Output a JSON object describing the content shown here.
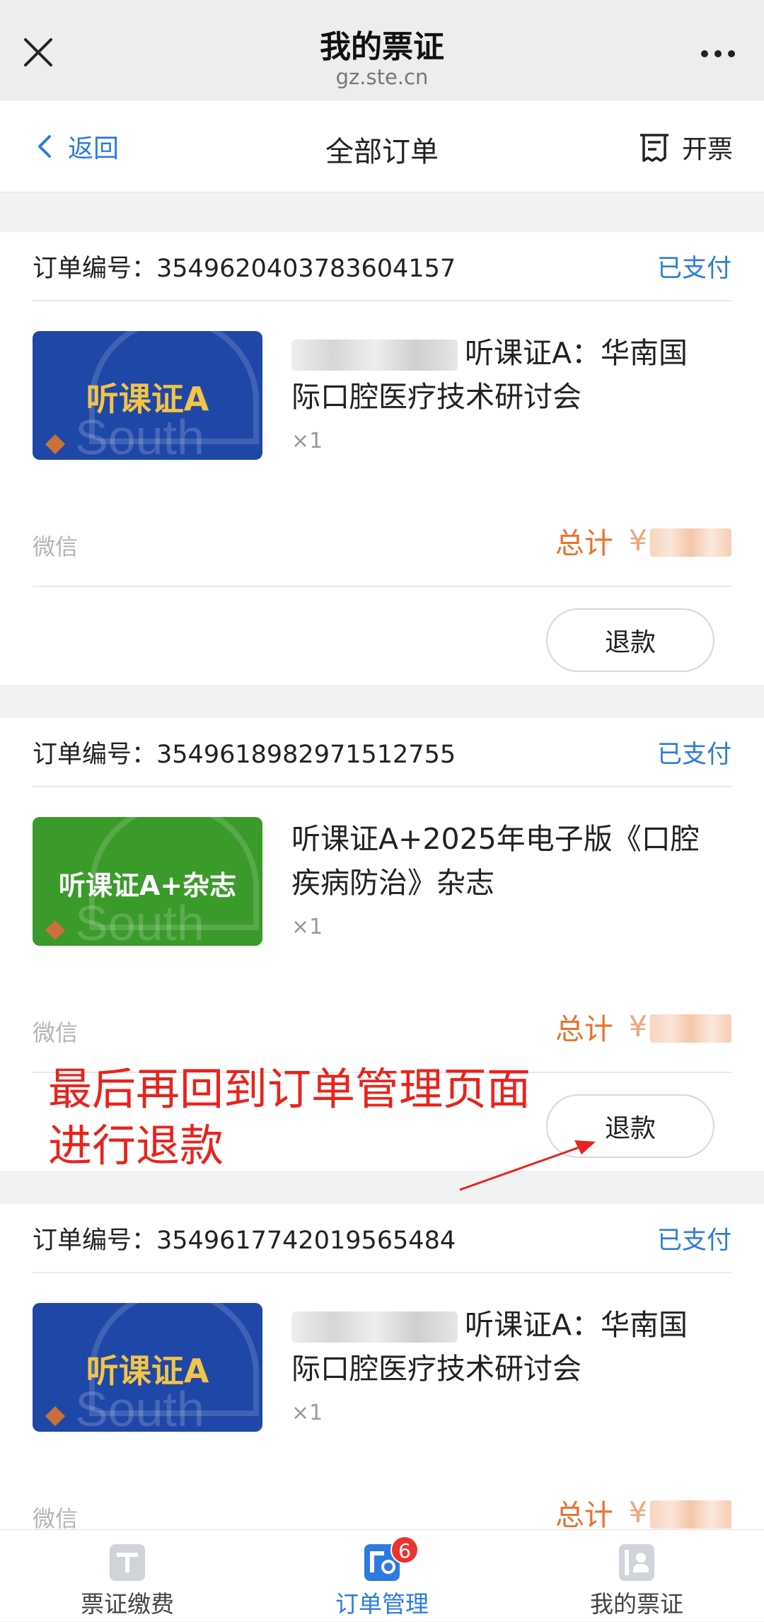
{
  "window": {
    "title": "我的票证",
    "url": "gz.ste.cn"
  },
  "nav": {
    "back_label": "返回",
    "title": "全部订单",
    "invoice_label": "开票"
  },
  "orders": [
    {
      "order_label": "订单编号：",
      "order_no": "3549620403783604157",
      "status": "已支付",
      "thumb_text": "听课证A",
      "product_name": "听课证A：华南国际口腔医疗技术研讨会",
      "qty": "×1",
      "pay_method": "微信",
      "total_label": "总计",
      "currency": "¥",
      "action": "退款"
    },
    {
      "order_label": "订单编号：",
      "order_no": "3549618982971512755",
      "status": "已支付",
      "thumb_text": "听课证A+杂志",
      "product_name": "听课证A+2025年电子版《口腔疾病防治》杂志",
      "qty": "×1",
      "pay_method": "微信",
      "total_label": "总计",
      "currency": "¥",
      "action": "退款"
    },
    {
      "order_label": "订单编号：",
      "order_no": "3549617742019565484",
      "status": "已支付",
      "thumb_text": "听课证A",
      "product_name": "听课证A：华南国际口腔医疗技术研讨会",
      "qty": "×1",
      "pay_method": "微信",
      "total_label": "总计",
      "currency": "¥"
    }
  ],
  "annotation": {
    "line1": "最后再回到订单管理页面",
    "line2": "进行退款"
  },
  "tabs": [
    {
      "label": "票证缴费"
    },
    {
      "label": "订单管理",
      "badge": "6"
    },
    {
      "label": "我的票证"
    }
  ],
  "colors": {
    "accent": "#2d7be0",
    "price": "#e8722e",
    "annotation": "#e8231d",
    "thumb_blue": "#1f47a8",
    "thumb_green": "#3a9a2a",
    "thumb_gold": "#f2c447"
  }
}
